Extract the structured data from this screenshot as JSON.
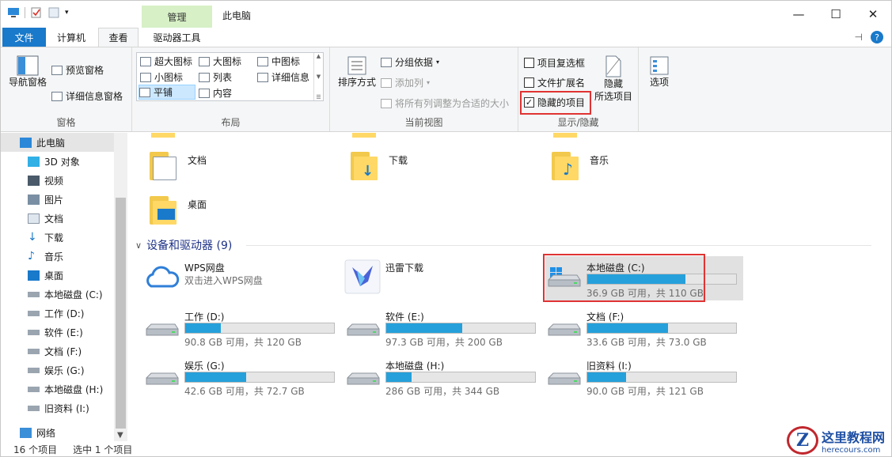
{
  "window": {
    "title": "此电脑",
    "context_tab_group": "管理",
    "minimize": "—",
    "maximize": "☐",
    "close": "✕"
  },
  "tabs": [
    {
      "label": "文件"
    },
    {
      "label": "计算机"
    },
    {
      "label": "查看"
    },
    {
      "label": "驱动器工具"
    }
  ],
  "ribbon": {
    "pane": {
      "nav_pane": "导航窗格",
      "preview": "预览窗格",
      "details": "详细信息窗格",
      "label": "窗格"
    },
    "layout": {
      "items": [
        "超大图标",
        "大图标",
        "中图标",
        "小图标",
        "列表",
        "详细信息",
        "平铺",
        "内容"
      ],
      "selected": "平铺",
      "label": "布局"
    },
    "current_view": {
      "sort": "排序方式",
      "group_by": "分组依据",
      "add_column": "添加列",
      "fit_columns": "将所有列调整为合适的大小",
      "label": "当前视图"
    },
    "show_hide": {
      "item_checkbox": "项目复选框",
      "file_ext": "文件扩展名",
      "hidden_items": "隐藏的项目",
      "hide_selected_1": "隐藏",
      "hide_selected_2": "所选项目",
      "label": "显示/隐藏"
    },
    "options": "选项"
  },
  "nav": [
    {
      "label": "此电脑",
      "icon": "pc-icon"
    },
    {
      "label": "3D 对象",
      "icon": "cube-icon"
    },
    {
      "label": "视频",
      "icon": "video-icon"
    },
    {
      "label": "图片",
      "icon": "picture-icon"
    },
    {
      "label": "文档",
      "icon": "document-icon"
    },
    {
      "label": "下载",
      "icon": "download-icon"
    },
    {
      "label": "音乐",
      "icon": "music-icon"
    },
    {
      "label": "桌面",
      "icon": "desktop-icon"
    },
    {
      "label": "本地磁盘 (C:)",
      "icon": "drive-icon"
    },
    {
      "label": "工作 (D:)",
      "icon": "drive-icon"
    },
    {
      "label": "软件 (E:)",
      "icon": "drive-icon"
    },
    {
      "label": "文档 (F:)",
      "icon": "drive-icon"
    },
    {
      "label": "娱乐 (G:)",
      "icon": "drive-icon"
    },
    {
      "label": "本地磁盘 (H:)",
      "icon": "drive-icon"
    },
    {
      "label": "旧资料 (I:)",
      "icon": "drive-icon"
    },
    {
      "label": "网络",
      "icon": "network-icon"
    }
  ],
  "folders": [
    {
      "label": "文档"
    },
    {
      "label": "下载"
    },
    {
      "label": "音乐"
    },
    {
      "label": "桌面"
    }
  ],
  "devices_header": "设备和驱动器 (9)",
  "wps": {
    "name": "WPS网盘",
    "sub": "双击进入WPS网盘"
  },
  "xunlei": {
    "name": "迅雷下载"
  },
  "drives": [
    {
      "name": "本地磁盘 (C:)",
      "sub": "36.9 GB 可用，共 110 GB",
      "used": 0.66
    },
    {
      "name": "工作 (D:)",
      "sub": "90.8 GB 可用，共 120 GB",
      "used": 0.24
    },
    {
      "name": "软件 (E:)",
      "sub": "97.3 GB 可用，共 200 GB",
      "used": 0.51
    },
    {
      "name": "文档 (F:)",
      "sub": "33.6 GB 可用，共 73.0 GB",
      "used": 0.54
    },
    {
      "name": "娱乐 (G:)",
      "sub": "42.6 GB 可用，共 72.7 GB",
      "used": 0.41
    },
    {
      "name": "本地磁盘 (H:)",
      "sub": "286 GB 可用，共 344 GB",
      "used": 0.17
    },
    {
      "name": "旧资料 (I:)",
      "sub": "90.0 GB 可用，共 121 GB",
      "used": 0.26
    }
  ],
  "status": {
    "count": "16 个项目",
    "selected": "选中 1 个项目"
  },
  "watermark": {
    "logo": "Z",
    "cn": "这里教程网",
    "url": "herecours.com"
  },
  "colors": {
    "accent": "#1979ca",
    "bar": "#26a0da",
    "highlight": "#e03333"
  }
}
